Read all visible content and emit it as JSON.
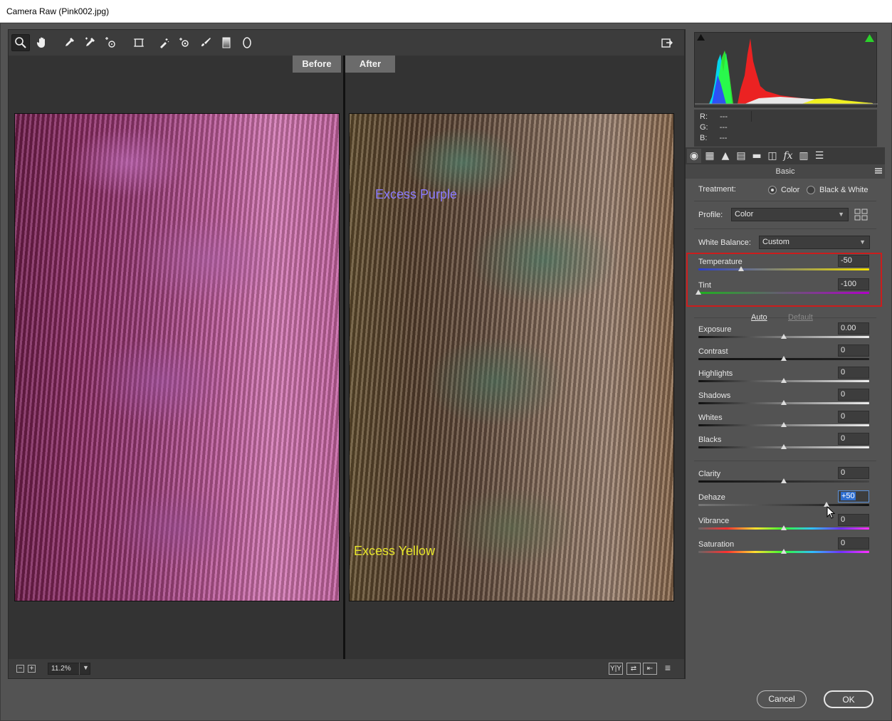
{
  "window": {
    "title": "Camera Raw (Pink002.jpg)"
  },
  "toolbar": {
    "tools": [
      {
        "name": "zoom-tool",
        "icon": "magnifier-icon"
      },
      {
        "name": "hand-tool",
        "icon": "hand-icon"
      },
      {
        "name": "white-balance-tool",
        "icon": "eyedropper-icon"
      },
      {
        "name": "color-sampler-tool",
        "icon": "color-sampler-icon"
      },
      {
        "name": "targeted-adjustment-tool",
        "icon": "target-adjust-icon"
      },
      {
        "name": "transform-tool",
        "icon": "transform-icon"
      },
      {
        "name": "spot-removal-tool",
        "icon": "spot-removal-icon"
      },
      {
        "name": "red-eye-tool",
        "icon": "red-eye-icon"
      },
      {
        "name": "adjustment-brush-tool",
        "icon": "brush-icon"
      },
      {
        "name": "graduated-filter-tool",
        "icon": "graduated-filter-icon"
      },
      {
        "name": "radial-filter-tool",
        "icon": "radial-filter-icon"
      }
    ],
    "open_preferences_icon": "export-icon"
  },
  "preview": {
    "before_label": "Before",
    "after_label": "After",
    "annotation_purple": "Excess Purple",
    "annotation_yellow": "Excess Yellow",
    "annotation_purple_color": "#8a7bff",
    "annotation_yellow_color": "#e8e62a",
    "zoom_minus": "−",
    "zoom_plus": "+",
    "zoom_level": "11.2%",
    "view_buttons": [
      "Y|Y",
      "⇄",
      "⇤",
      "≡"
    ]
  },
  "histogram": {
    "r_label": "R:",
    "g_label": "G:",
    "b_label": "B:",
    "r_value": "---",
    "g_value": "---",
    "b_value": "---"
  },
  "panel": {
    "title": "Basic",
    "treatment_label": "Treatment:",
    "treatment_color": "Color",
    "treatment_bw": "Black & White",
    "treatment_selected": "Color",
    "profile_label": "Profile:",
    "profile_value": "Color",
    "wb_label": "White Balance:",
    "wb_value": "Custom",
    "auto_link": "Auto",
    "default_link": "Default",
    "highlight_color": "#cc1d1d",
    "sliders": [
      {
        "key": "temperature",
        "label": "Temperature",
        "value": "-50",
        "fraction": 0.25,
        "gradient": "linear-gradient(90deg,#2b3fc9,#f2e000)"
      },
      {
        "key": "tint",
        "label": "Tint",
        "value": "-100",
        "fraction": 0.0,
        "gradient": "linear-gradient(90deg,#1fb11f,#b000c8)"
      },
      {
        "key": "exposure",
        "label": "Exposure",
        "value": "0.00",
        "fraction": 0.5,
        "gradient": "linear-gradient(90deg,#111,#eee)"
      },
      {
        "key": "contrast",
        "label": "Contrast",
        "value": "0",
        "fraction": 0.5,
        "gradient": "linear-gradient(90deg,#111,#222)"
      },
      {
        "key": "highlights",
        "label": "Highlights",
        "value": "0",
        "fraction": 0.5,
        "gradient": "linear-gradient(90deg,#111,#eee)"
      },
      {
        "key": "shadows",
        "label": "Shadows",
        "value": "0",
        "fraction": 0.5,
        "gradient": "linear-gradient(90deg,#111,#eee)"
      },
      {
        "key": "whites",
        "label": "Whites",
        "value": "0",
        "fraction": 0.5,
        "gradient": "linear-gradient(90deg,#111,#eee)"
      },
      {
        "key": "blacks",
        "label": "Blacks",
        "value": "0",
        "fraction": 0.5,
        "gradient": "linear-gradient(90deg,#111,#eee)"
      },
      {
        "key": "clarity",
        "label": "Clarity",
        "value": "0",
        "fraction": 0.5,
        "gradient": "linear-gradient(90deg,#111,#444)"
      },
      {
        "key": "dehaze",
        "label": "Dehaze",
        "value": "+50",
        "fraction": 0.75,
        "gradient": "linear-gradient(90deg,#777,#111)"
      },
      {
        "key": "vibrance",
        "label": "Vibrance",
        "value": "0",
        "fraction": 0.5,
        "gradient": "linear-gradient(90deg,#666,#ff3030,#ffe030,#30ff30,#30c0ff,#7030ff,#ff30ff)"
      },
      {
        "key": "saturation",
        "label": "Saturation",
        "value": "0",
        "fraction": 0.5,
        "gradient": "linear-gradient(90deg,#666,#ff3030,#ffe030,#30ff30,#30c0ff,#7030ff,#ff30ff)"
      }
    ]
  },
  "dialog": {
    "cancel_label": "Cancel",
    "ok_label": "OK"
  }
}
